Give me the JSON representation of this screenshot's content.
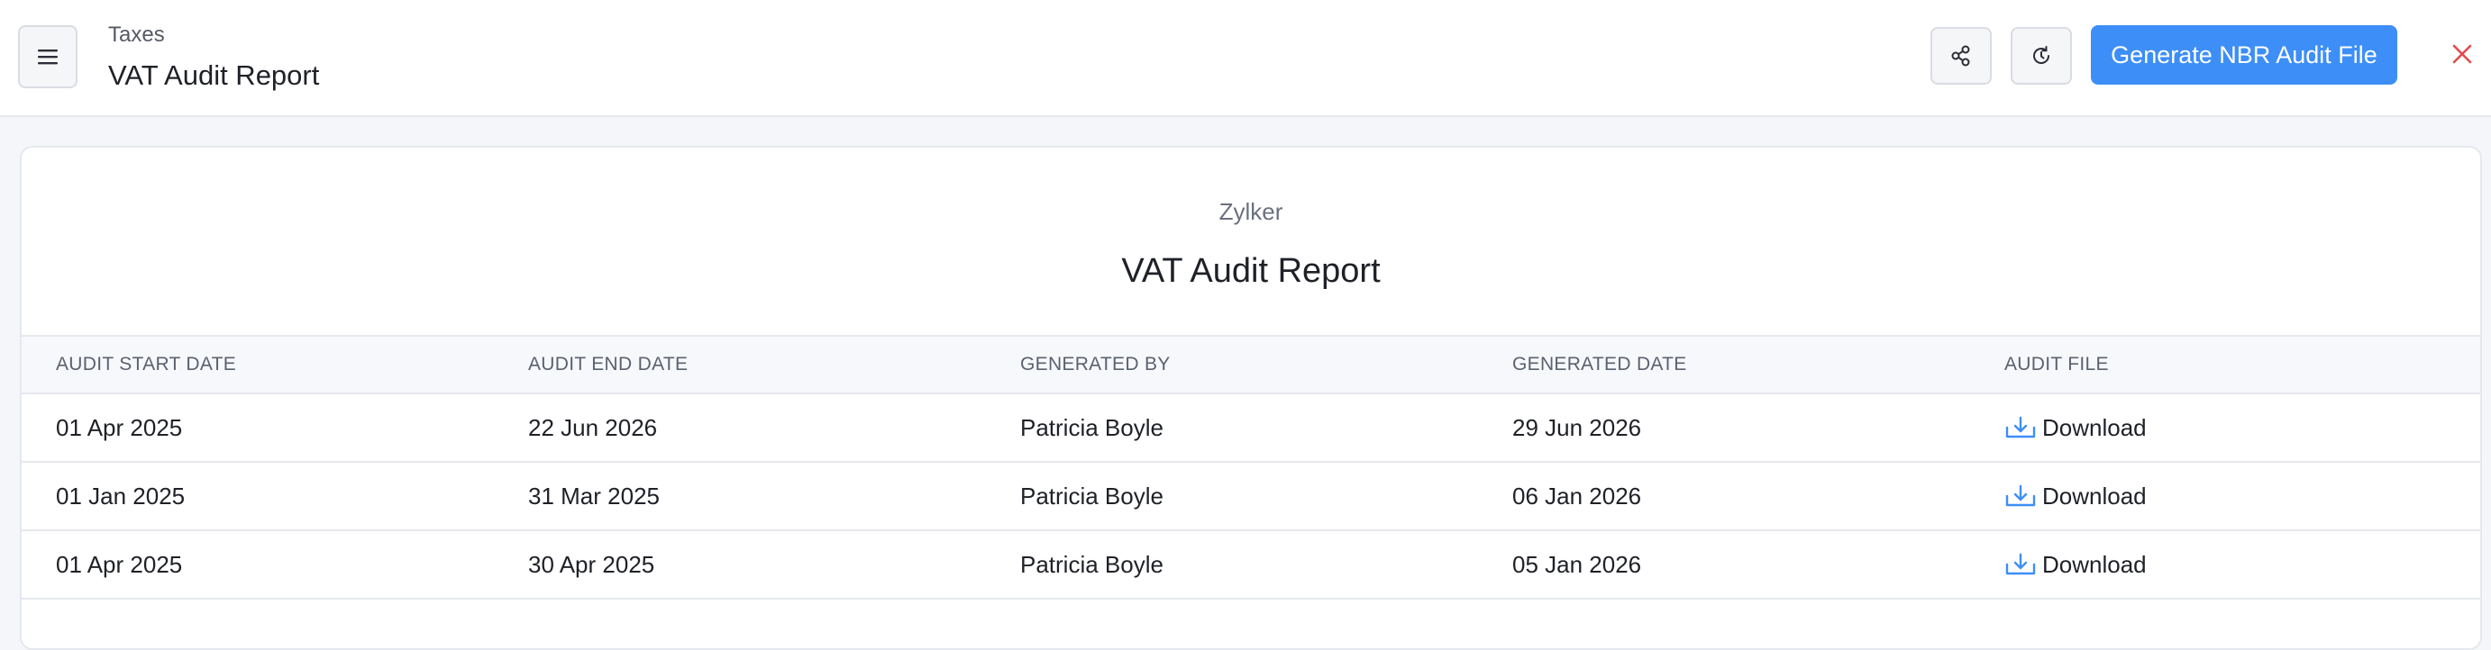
{
  "header": {
    "breadcrumb": "Taxes",
    "title": "VAT Audit Report",
    "generate_button": "Generate NBR Audit File"
  },
  "report": {
    "org_name": "Zylker",
    "title": "VAT Audit Report"
  },
  "table": {
    "columns": [
      "AUDIT START DATE",
      "AUDIT END DATE",
      "GENERATED BY",
      "GENERATED DATE",
      "AUDIT FILE"
    ],
    "rows": [
      {
        "start": "01 Apr 2025",
        "end": "22 Jun 2026",
        "by": "Patricia Boyle",
        "generated": "29 Jun 2026",
        "file": "Download"
      },
      {
        "start": "01 Jan 2025",
        "end": "31 Mar 2025",
        "by": "Patricia Boyle",
        "generated": "06 Jan 2026",
        "file": "Download"
      },
      {
        "start": "01 Apr 2025",
        "end": "30 Apr 2025",
        "by": "Patricia Boyle",
        "generated": "05 Jan 2026",
        "file": "Download"
      }
    ]
  },
  "icons": {
    "menu": "hamburger-menu-icon",
    "share": "share-icon",
    "refresh": "refresh-icon",
    "close": "close-icon",
    "download": "download-icon"
  },
  "colors": {
    "accent": "#3d8ef7",
    "close": "#e5484d",
    "download_icon": "#3d8ef7"
  }
}
